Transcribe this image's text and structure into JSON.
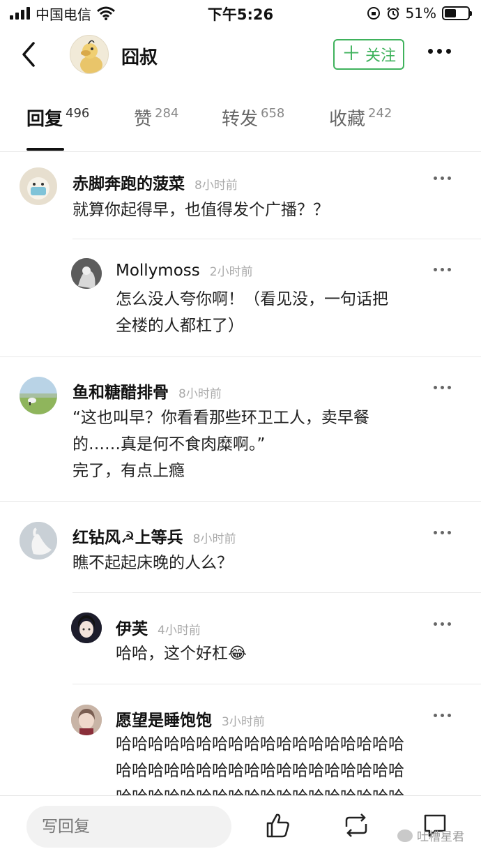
{
  "status_bar": {
    "carrier": "中国电信",
    "time": "下午5:26",
    "battery": "51%",
    "battery_level": 0.51
  },
  "header": {
    "title": "囧叔",
    "follow_label": "关注",
    "accent_color": "#3fb25c"
  },
  "tabs": [
    {
      "label": "回复",
      "count": "496",
      "active": true
    },
    {
      "label": "赞",
      "count": "284",
      "active": false
    },
    {
      "label": "转发",
      "count": "658",
      "active": false
    },
    {
      "label": "收藏",
      "count": "242",
      "active": false
    }
  ],
  "comments": [
    {
      "name": "赤脚奔跑的菠菜",
      "time": "8小时前",
      "lines": [
        "就算你起得早，也值得发个广播？？"
      ],
      "replies": [
        {
          "name": "Mollymoss",
          "time": "2小时前",
          "lines": [
            "怎么没人夸你啊！（看见没，一句话把",
            "全楼的人都杠了）"
          ]
        }
      ]
    },
    {
      "name": "鱼和糖醋排骨",
      "time": "8小时前",
      "lines": [
        "“这也叫早？你看看那些环卫工人，卖早餐",
        "的……真是何不食肉糜啊。”",
        "完了，有点上瘾"
      ],
      "replies": []
    },
    {
      "name": "红钻风☭上等兵",
      "time": "8小时前",
      "lines": [
        "瞧不起起床晚的人么？"
      ],
      "replies": [
        {
          "name": "伊芙",
          "time": "4小时前",
          "lines": [
            "哈哈，这个好杠😂"
          ]
        },
        {
          "name": "愿望是睡饱饱",
          "time": "3小时前",
          "lines": [
            "哈哈哈哈哈哈哈哈哈哈哈哈哈哈哈哈哈哈",
            "哈哈哈哈哈哈哈哈哈哈哈哈哈哈哈哈哈哈",
            "哈哈哈哈哈哈哈哈哈哈哈哈哈哈哈哈哈哈"
          ]
        }
      ]
    }
  ],
  "bottom_bar": {
    "reply_placeholder": "写回复",
    "icons": [
      "thumbs-up-icon",
      "repost-icon",
      "comment-icon"
    ]
  },
  "watermark": "吐槽星君"
}
